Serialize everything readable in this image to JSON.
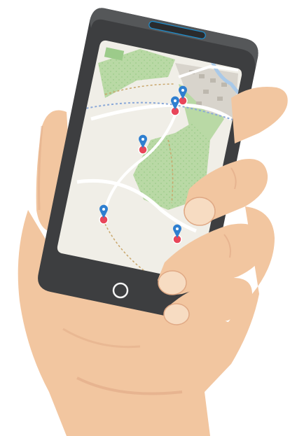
{
  "scene": {
    "subject": "hand-holding-phone-illustration",
    "colors": {
      "skin": "#f2c6a0",
      "skin_shadow": "#e0a985",
      "nail": "#f7dcc2",
      "phone_body": "#3d3e40",
      "screen_frame": "#2b2c2e",
      "map_base": "#f0eee7",
      "forest": "#b9d9a5",
      "forest_dots": "#9ccb8a",
      "road": "#ffffff",
      "path_dashed": "#c9a66b",
      "route_blue": "#8aa8d8",
      "town": "#d8d4cc",
      "river": "#a9c9e8",
      "pin_blue": "#2f7fd0",
      "pin_base_red": "#e8465a"
    },
    "map": {
      "markers": [
        {
          "name": "marker-1"
        },
        {
          "name": "marker-2"
        },
        {
          "name": "marker-3"
        },
        {
          "name": "marker-4"
        },
        {
          "name": "marker-5"
        },
        {
          "name": "marker-6"
        }
      ]
    }
  }
}
